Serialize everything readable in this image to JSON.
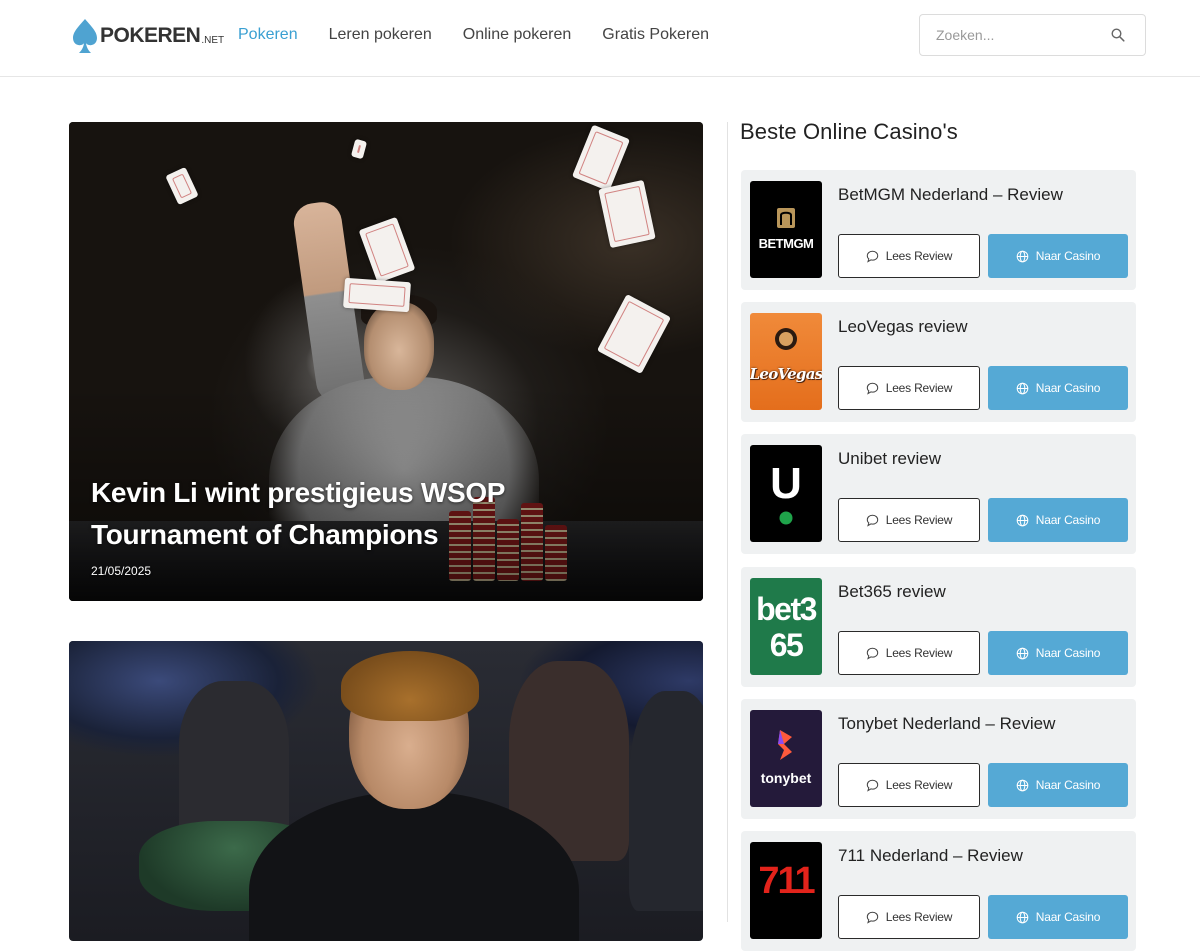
{
  "header": {
    "logo_text": "POKEREN",
    "logo_tld": ".NET",
    "nav": [
      {
        "label": "Pokeren",
        "active": true
      },
      {
        "label": "Leren pokeren",
        "active": false
      },
      {
        "label": "Online pokeren",
        "active": false
      },
      {
        "label": "Gratis Pokeren",
        "active": false
      }
    ],
    "search": {
      "placeholder": "Zoeken...",
      "value": ""
    }
  },
  "articles": [
    {
      "title": "Kevin Li wint prestigieus WSOP Tournament of Champions",
      "date": "21/05/2025"
    },
    {
      "title": "",
      "date": ""
    }
  ],
  "sidebar": {
    "title": "Beste Online Casino's",
    "casinos": [
      {
        "name": "BetMGM Nederland – Review",
        "logo": "BETMGM",
        "review_label": "Lees Review",
        "casino_label": "Naar Casino"
      },
      {
        "name": "LeoVegas review",
        "logo": "LeoVegas",
        "review_label": "Lees Review",
        "casino_label": "Naar Casino"
      },
      {
        "name": "Unibet review",
        "logo": "U",
        "review_label": "Lees Review",
        "casino_label": "Naar Casino"
      },
      {
        "name": "Bet365 review",
        "logo": "bet365",
        "review_label": "Lees Review",
        "casino_label": "Naar Casino"
      },
      {
        "name": "Tonybet Nederland – Review",
        "logo": "tonybet",
        "review_label": "Lees Review",
        "casino_label": "Naar Casino"
      },
      {
        "name": "711 Nederland – Review",
        "logo": "711",
        "review_label": "Lees Review",
        "casino_label": "Naar Casino"
      }
    ]
  },
  "colors": {
    "accent": "#3aa0d2",
    "casino_button": "#55a9d5",
    "card_bg": "#eff1f2"
  }
}
